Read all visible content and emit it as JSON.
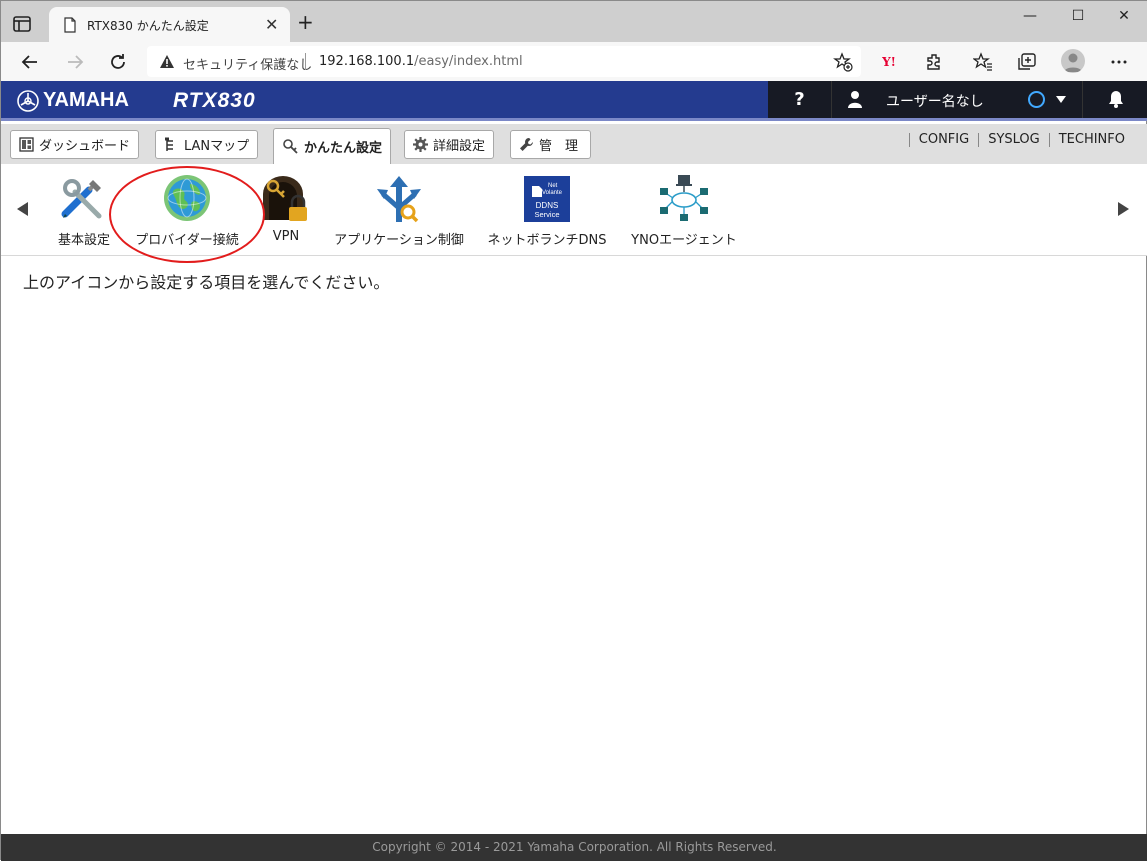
{
  "browser": {
    "tab_title": "RTX830 かんたん設定",
    "security_label": "セキュリティ保護なし",
    "url_host": "192.168.100.1",
    "url_path": "/easy/index.html",
    "yahoo_badge": "Y!"
  },
  "header": {
    "brand": "YAMAHA",
    "model": "RTX830",
    "help": "?",
    "user_name": "ユーザー名なし"
  },
  "menu": {
    "tabs": [
      {
        "label": "ダッシュボード"
      },
      {
        "label": "LANマップ"
      },
      {
        "label": "かんたん設定"
      },
      {
        "label": "詳細設定"
      },
      {
        "label": "管　理"
      }
    ],
    "links": [
      "CONFIG",
      "SYSLOG",
      "TECHINFO"
    ]
  },
  "icons": {
    "items": [
      {
        "label": "基本設定",
        "icon": "tools-icon"
      },
      {
        "label": "プロバイダー接続",
        "icon": "globe-icon"
      },
      {
        "label": "VPN",
        "icon": "vpn-lock-icon"
      },
      {
        "label": "アプリケーション制御",
        "icon": "app-control-icon"
      },
      {
        "label": "ネットボランチDNS",
        "icon": "ddns-icon"
      },
      {
        "label": "YNOエージェント",
        "icon": "network-icon"
      }
    ],
    "ddns_badge": {
      "line1": "Net",
      "line2": "Volante",
      "line3": "DDNS",
      "line4": "Service"
    }
  },
  "main": {
    "message": "上のアイコンから設定する項目を選んでください。"
  },
  "footer": {
    "copyright": "Copyright © 2014 - 2021 Yamaha Corporation. All Rights Reserved."
  }
}
